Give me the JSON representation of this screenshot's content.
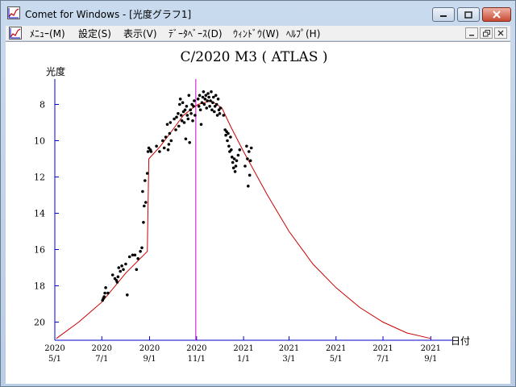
{
  "window": {
    "title": "Comet for Windows - [光度グラフ1]"
  },
  "menu": {
    "items": [
      {
        "label": "ﾒﾆｭｰ(M)",
        "key": "menu"
      },
      {
        "label": "設定(S)",
        "key": "settings"
      },
      {
        "label": "表示(V)",
        "key": "view"
      },
      {
        "label": "ﾃﾞｰﾀﾍﾞｰｽ(D)",
        "key": "database"
      },
      {
        "label": "ｳｨﾝﾄﾞｳ(W)",
        "key": "window"
      },
      {
        "label": "ﾍﾙﾌﾟ(H)",
        "key": "help"
      }
    ]
  },
  "colors": {
    "axis": "#0000cc",
    "curve": "#cc0000",
    "marker": "#cc00cc",
    "points": "#000000"
  },
  "chart_data": {
    "type": "scatter",
    "title": "C/2020 M3 ( ATLAS )",
    "ylabel": "光度",
    "xlabel": "日付",
    "ylim": [
      21,
      6.6
    ],
    "y_inverted": true,
    "xlim": [
      "2020-05-01",
      "2021-09-30"
    ],
    "y_ticks": [
      8,
      10,
      12,
      14,
      16,
      18,
      20
    ],
    "x_ticks": [
      {
        "date": "2020-05-01",
        "top": "2020",
        "bottom": "5/1"
      },
      {
        "date": "2020-07-01",
        "top": "2020",
        "bottom": "7/1"
      },
      {
        "date": "2020-09-01",
        "top": "2020",
        "bottom": "9/1"
      },
      {
        "date": "2020-11-01",
        "top": "2020",
        "bottom": "11/1"
      },
      {
        "date": "2021-01-01",
        "top": "2021",
        "bottom": "1/1"
      },
      {
        "date": "2021-03-01",
        "top": "2021",
        "bottom": "3/1"
      },
      {
        "date": "2021-05-01",
        "top": "2021",
        "bottom": "5/1"
      },
      {
        "date": "2021-07-01",
        "top": "2021",
        "bottom": "7/1"
      },
      {
        "date": "2021-09-01",
        "top": "2021",
        "bottom": "9/1"
      }
    ],
    "marker_date": "2020-10-31",
    "predicted_curve": [
      [
        "2020-05-03",
        20.9
      ],
      [
        "2020-06-01",
        20.0
      ],
      [
        "2020-07-01",
        18.9
      ],
      [
        "2020-08-01",
        17.3
      ],
      [
        "2020-08-29",
        16.1
      ],
      [
        "2020-08-31",
        11.0
      ],
      [
        "2020-09-15",
        10.3
      ],
      [
        "2020-10-01",
        9.4
      ],
      [
        "2020-10-15",
        8.6
      ],
      [
        "2020-10-27",
        8.2
      ],
      [
        "2020-11-03",
        8.0
      ],
      [
        "2020-11-20",
        7.8
      ],
      [
        "2020-12-04",
        8.2
      ],
      [
        "2020-12-15",
        9.2
      ],
      [
        "2021-01-01",
        10.6
      ],
      [
        "2021-02-01",
        13.0
      ],
      [
        "2021-03-01",
        15.0
      ],
      [
        "2021-04-01",
        16.8
      ],
      [
        "2021-05-01",
        18.1
      ],
      [
        "2021-06-01",
        19.2
      ],
      [
        "2021-07-01",
        20.0
      ],
      [
        "2021-08-01",
        20.6
      ],
      [
        "2021-09-01",
        20.9
      ]
    ],
    "observations": [
      [
        "2020-07-02",
        18.8
      ],
      [
        "2020-07-03",
        18.7
      ],
      [
        "2020-07-04",
        18.6
      ],
      [
        "2020-07-05",
        18.4
      ],
      [
        "2020-07-06",
        18.1
      ],
      [
        "2020-07-09",
        18.4
      ],
      [
        "2020-07-15",
        17.4
      ],
      [
        "2020-07-18",
        17.6
      ],
      [
        "2020-07-20",
        17.7
      ],
      [
        "2020-07-21",
        17.8
      ],
      [
        "2020-07-22",
        17.5
      ],
      [
        "2020-07-23",
        17.0
      ],
      [
        "2020-07-25",
        17.2
      ],
      [
        "2020-07-27",
        16.9
      ],
      [
        "2020-07-29",
        17.1
      ],
      [
        "2020-08-01",
        16.8
      ],
      [
        "2020-08-03",
        18.5
      ],
      [
        "2020-08-06",
        16.4
      ],
      [
        "2020-08-10",
        16.3
      ],
      [
        "2020-08-13",
        16.3
      ],
      [
        "2020-08-15",
        17.1
      ],
      [
        "2020-08-17",
        16.5
      ],
      [
        "2020-08-20",
        16.1
      ],
      [
        "2020-08-22",
        15.9
      ],
      [
        "2020-08-23",
        12.8
      ],
      [
        "2020-08-24",
        14.5
      ],
      [
        "2020-08-25",
        13.6
      ],
      [
        "2020-08-26",
        12.2
      ],
      [
        "2020-08-27",
        13.4
      ],
      [
        "2020-08-29",
        11.8
      ],
      [
        "2020-08-30",
        10.6
      ],
      [
        "2020-08-31",
        10.4
      ],
      [
        "2020-09-02",
        10.5
      ],
      [
        "2020-09-03",
        10.6
      ],
      [
        "2020-09-10",
        10.3
      ],
      [
        "2020-09-14",
        10.6
      ],
      [
        "2020-09-18",
        10.0
      ],
      [
        "2020-09-20",
        10.4
      ],
      [
        "2020-09-22",
        9.8
      ],
      [
        "2020-09-24",
        9.1
      ],
      [
        "2020-09-25",
        10.5
      ],
      [
        "2020-09-26",
        10.2
      ],
      [
        "2020-09-27",
        9.6
      ],
      [
        "2020-09-28",
        9.0
      ],
      [
        "2020-09-29",
        10.0
      ],
      [
        "2020-10-03",
        8.8
      ],
      [
        "2020-10-05",
        9.4
      ],
      [
        "2020-10-06",
        8.7
      ],
      [
        "2020-10-08",
        8.5
      ],
      [
        "2020-10-09",
        9.2
      ],
      [
        "2020-10-10",
        8.0
      ],
      [
        "2020-10-11",
        7.7
      ],
      [
        "2020-10-12",
        8.6
      ],
      [
        "2020-10-13",
        8.9
      ],
      [
        "2020-10-14",
        7.9
      ],
      [
        "2020-10-15",
        8.4
      ],
      [
        "2020-10-16",
        9.0
      ],
      [
        "2020-10-17",
        8.3
      ],
      [
        "2020-10-18",
        9.9
      ],
      [
        "2020-10-19",
        8.1
      ],
      [
        "2020-10-20",
        8.6
      ],
      [
        "2020-10-21",
        8.8
      ],
      [
        "2020-10-22",
        7.5
      ],
      [
        "2020-10-23",
        10.1
      ],
      [
        "2020-10-24",
        8.3
      ],
      [
        "2020-10-25",
        8.5
      ],
      [
        "2020-10-26",
        8.0
      ],
      [
        "2020-10-27",
        8.9
      ],
      [
        "2020-10-28",
        8.1
      ],
      [
        "2020-10-29",
        7.8
      ],
      [
        "2020-10-30",
        8.6
      ],
      [
        "2020-11-03",
        7.7
      ],
      [
        "2020-11-04",
        8.1
      ],
      [
        "2020-11-05",
        7.5
      ],
      [
        "2020-11-06",
        8.3
      ],
      [
        "2020-11-07",
        9.1
      ],
      [
        "2020-11-08",
        7.9
      ],
      [
        "2020-11-09",
        7.6
      ],
      [
        "2020-11-10",
        7.3
      ],
      [
        "2020-11-11",
        8.0
      ],
      [
        "2020-11-12",
        7.7
      ],
      [
        "2020-11-13",
        7.5
      ],
      [
        "2020-11-14",
        8.2
      ],
      [
        "2020-11-15",
        7.8
      ],
      [
        "2020-11-16",
        7.4
      ],
      [
        "2020-11-17",
        7.6
      ],
      [
        "2020-11-18",
        8.1
      ],
      [
        "2020-11-19",
        7.8
      ],
      [
        "2020-11-20",
        7.3
      ],
      [
        "2020-11-21",
        8.3
      ],
      [
        "2020-11-22",
        7.9
      ],
      [
        "2020-11-23",
        7.6
      ],
      [
        "2020-11-24",
        8.4
      ],
      [
        "2020-11-25",
        8.1
      ],
      [
        "2020-11-26",
        7.5
      ],
      [
        "2020-11-27",
        8.0
      ],
      [
        "2020-11-28",
        8.6
      ],
      [
        "2020-11-29",
        7.7
      ],
      [
        "2020-11-30",
        8.3
      ],
      [
        "2020-12-01",
        8.5
      ],
      [
        "2020-12-02",
        8.2
      ],
      [
        "2020-12-06",
        8.6
      ],
      [
        "2020-12-08",
        9.4
      ],
      [
        "2020-12-09",
        9.7
      ],
      [
        "2020-12-10",
        9.5
      ],
      [
        "2020-12-11",
        10.0
      ],
      [
        "2020-12-12",
        9.6
      ],
      [
        "2020-12-13",
        10.3
      ],
      [
        "2020-12-14",
        10.6
      ],
      [
        "2020-12-15",
        9.8
      ],
      [
        "2020-12-16",
        10.5
      ],
      [
        "2020-12-17",
        10.9
      ],
      [
        "2020-12-18",
        11.2
      ],
      [
        "2020-12-19",
        11.5
      ],
      [
        "2020-12-20",
        11.0
      ],
      [
        "2020-12-21",
        11.7
      ],
      [
        "2020-12-22",
        11.4
      ],
      [
        "2020-12-23",
        11.1
      ],
      [
        "2020-12-25",
        10.8
      ],
      [
        "2020-12-27",
        10.5
      ],
      [
        "2021-01-03",
        11.4
      ],
      [
        "2021-01-05",
        10.3
      ],
      [
        "2021-01-06",
        11.0
      ],
      [
        "2021-01-07",
        12.5
      ],
      [
        "2021-01-08",
        10.6
      ],
      [
        "2021-01-09",
        11.9
      ],
      [
        "2021-01-10",
        11.1
      ],
      [
        "2021-01-11",
        10.4
      ]
    ]
  }
}
